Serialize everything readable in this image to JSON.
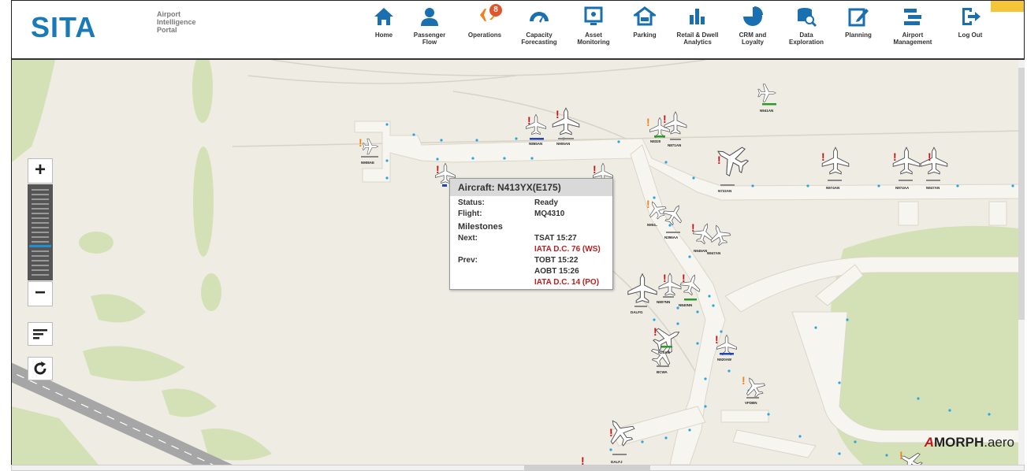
{
  "brand": {
    "logo_text": "SITA",
    "subtitle_lines": [
      "Airport",
      "Intelligence",
      "Portal"
    ]
  },
  "nav": [
    {
      "label": "Home",
      "icon": "home-icon"
    },
    {
      "label": "Passenger\nFlow",
      "icon": "passenger-icon"
    },
    {
      "label": "Operations",
      "icon": "operations-icon",
      "badge": "8"
    },
    {
      "label": "Capacity\nForecasting",
      "icon": "gauge-icon"
    },
    {
      "label": "Asset\nMonitoring",
      "icon": "monitor-icon"
    },
    {
      "label": "Parking",
      "icon": "car-icon"
    },
    {
      "label": "Retail & Dwell\nAnalytics",
      "icon": "bar-chart-icon"
    },
    {
      "label": "CRM and\nLoyalty",
      "icon": "pie-chart-icon"
    },
    {
      "label": "Data\nExploration",
      "icon": "database-search-icon"
    },
    {
      "label": "Planning",
      "icon": "edit-icon"
    },
    {
      "label": "Airport\nManagement",
      "icon": "list-icon"
    },
    {
      "label": "Log Out",
      "icon": "logout-icon"
    }
  ],
  "tooltip": {
    "title": "Aircraft: N413YX(E175)",
    "status_label": "Status:",
    "status_value": "Ready",
    "flight_label": "Flight:",
    "flight_value": "MQ4310",
    "milestones_label": "Milestones",
    "next_label": "Next:",
    "next_value": "TSAT 15:27",
    "next_alert": "IATA D.C. 76 (WS)",
    "prev_label": "Prev:",
    "prev_value_1": "TOBT 15:22",
    "prev_value_2": "AOBT 15:26",
    "prev_alert": "IATA D.C. 14 (PO)"
  },
  "footer": {
    "brand": "MORPH",
    "suffix": ".aero"
  },
  "aircraft_labels": [
    "N908AE",
    "N865AN",
    "N905AN",
    "N8320",
    "N871AN",
    "N941AN",
    "N722AN",
    "N974AN",
    "N974AA",
    "N947AN",
    "N904..",
    "N396AA",
    "N945AN",
    "N947AN",
    "N807NN",
    "N840NN",
    "DALFG",
    "N20AN",
    "N920AW",
    "BCWA",
    "VFDBN",
    "DALFJ"
  ],
  "colors": {
    "map_bg": "#efece4",
    "terminal": "#f7f5f0",
    "green": "#d4e1b6",
    "alert_red": "#b22222",
    "alert_orange": "#f0821c",
    "accent_blue": "#1e90d6"
  }
}
